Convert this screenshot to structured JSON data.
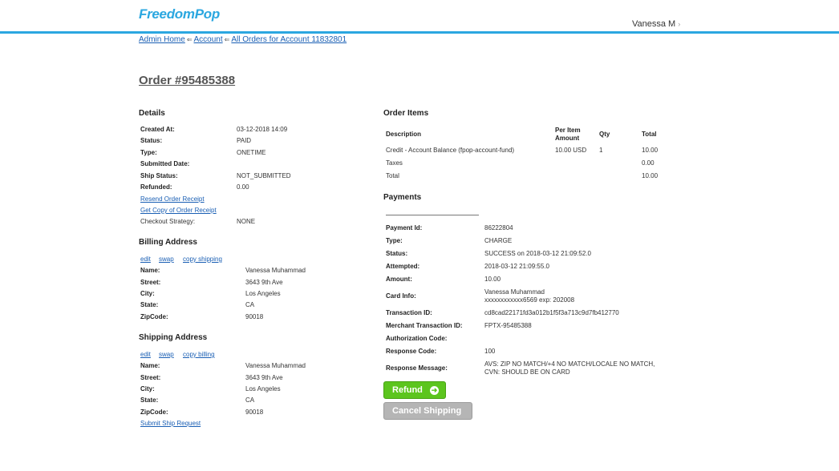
{
  "header": {
    "logo": "FreedomPop",
    "user_name": "Vanessa M",
    "user_chevron": "›"
  },
  "breadcrumb": [
    {
      "label": "Admin Home"
    },
    {
      "label": "Account"
    },
    {
      "label": "All Orders for Account 11832801"
    }
  ],
  "breadcrumb_sep": "⇐",
  "page_title": "Order #95485388",
  "details": {
    "heading": "Details",
    "fields": [
      {
        "label": "Created At:",
        "value": "03-12-2018 14:09"
      },
      {
        "label": "Status:",
        "value": "PAID"
      },
      {
        "label": "Type:",
        "value": "ONETIME"
      },
      {
        "label": "Submitted Date:",
        "value": ""
      },
      {
        "label": "Ship Status:",
        "value": "NOT_SUBMITTED"
      },
      {
        "label": "Refunded:",
        "value": "0.00"
      }
    ],
    "links": [
      "Resend Order Receipt",
      "Get Copy of Order Receipt"
    ],
    "checkout_label": "Checkout Strategy:",
    "checkout_value": "NONE"
  },
  "billing": {
    "heading": "Billing Address",
    "actions": [
      "edit",
      "swap",
      "copy shipping"
    ],
    "fields": [
      {
        "label": "Name:",
        "value": "Vanessa Muhammad"
      },
      {
        "label": "Street:",
        "value": "3643 9th Ave"
      },
      {
        "label": "City:",
        "value": "Los Angeles"
      },
      {
        "label": "State:",
        "value": "CA"
      },
      {
        "label": "ZipCode:",
        "value": "90018"
      }
    ]
  },
  "shipping": {
    "heading": "Shipping Address",
    "actions": [
      "edit",
      "swap",
      "copy billing"
    ],
    "fields": [
      {
        "label": "Name:",
        "value": "Vanessa Muhammad"
      },
      {
        "label": "Street:",
        "value": "3643 9th Ave"
      },
      {
        "label": "City:",
        "value": "Los Angeles"
      },
      {
        "label": "State:",
        "value": "CA"
      },
      {
        "label": "ZipCode:",
        "value": "90018"
      }
    ],
    "submit_link": "Submit Ship Request"
  },
  "order_items": {
    "heading": "Order Items",
    "columns": {
      "description": "Description",
      "per_item_1": "Per Item",
      "per_item_2": "Amount",
      "qty": "Qty",
      "total": "Total"
    },
    "rows": [
      {
        "description": "Credit - Account Balance (fpop-account-fund)",
        "per_item": "10.00 USD",
        "qty": "1",
        "total": "10.00"
      },
      {
        "description": "Taxes",
        "per_item": "",
        "qty": "",
        "total": "0.00"
      },
      {
        "description": "Total",
        "per_item": "",
        "qty": "",
        "total": "10.00"
      }
    ]
  },
  "payments": {
    "heading": "Payments",
    "fields": [
      {
        "label": "Payment Id:",
        "value": "86222804"
      },
      {
        "label": "Type:",
        "value": "CHARGE"
      },
      {
        "label": "Status:",
        "value": "SUCCESS on 2018-03-12 21:09:52.0"
      },
      {
        "label": "Attempted:",
        "value": "2018-03-12 21:09:55.0"
      },
      {
        "label": "Amount:",
        "value": "10.00"
      },
      {
        "label": "Card Info:",
        "value": "Vanessa Muhammad",
        "value2": "xxxxxxxxxxxx6569 exp: 202008"
      },
      {
        "label": "Transaction ID:",
        "value": "cd8cad22171fd3a012b1f5f3a713c9d7fb412770"
      },
      {
        "label": "Merchant Transaction ID:",
        "value": "FPTX-95485388"
      },
      {
        "label": "Authorization Code:",
        "value": ""
      },
      {
        "label": "Response Code:",
        "value": "100"
      },
      {
        "label": "Response Message:",
        "value": "AVS: ZIP NO MATCH/+4 NO MATCH/LOCALE NO MATCH,",
        "value2": "CVN: SHOULD BE ON CARD"
      }
    ]
  },
  "buttons": {
    "refund": "Refund",
    "refund_icon": "arrow-right-circle-icon",
    "cancel_shipping": "Cancel Shipping"
  },
  "colors": {
    "brand": "#2ba7e0",
    "link": "#1a5fb4",
    "refund": "#5cc51e",
    "cancel": "#b5b5b5"
  }
}
